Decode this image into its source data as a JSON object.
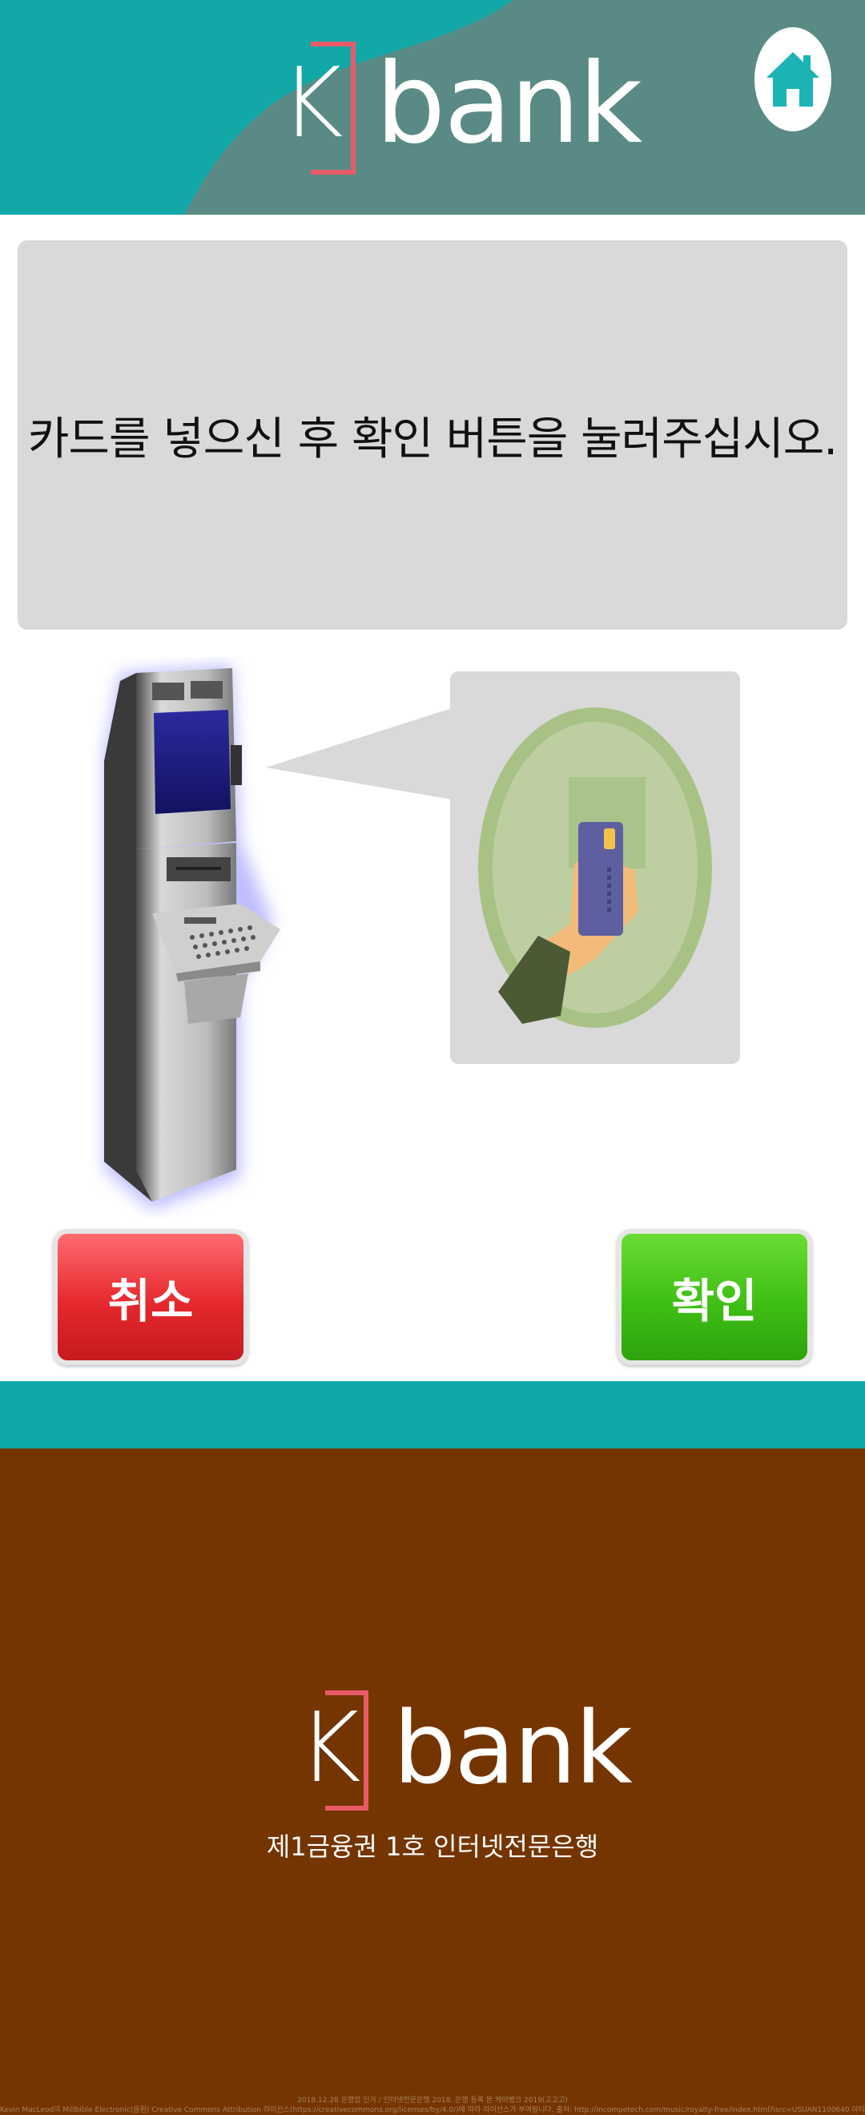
{
  "header": {
    "logo_letter": "K",
    "logo_word": "bank",
    "home_icon": "home-icon"
  },
  "instruction": {
    "text": "카드를 넣으신 후 확인 버튼을 눌러주십시오."
  },
  "illustration": {
    "atm": "atm-machine-image",
    "card": "hand-inserting-card-image"
  },
  "buttons": {
    "cancel_label": "취소",
    "confirm_label": "확인"
  },
  "footer": {
    "logo_letter": "K",
    "logo_word": "bank",
    "tagline": "제1금융권 1호 인터넷전문은행",
    "credit_line1": "2018.12.28 은행업 인가 / 인터넷전문은행 2018. 은행 등록 본 케이뱅크 2019(고고고)",
    "credit_line2": "Kevin MacLeod의 Millbible Electronic(음원) Creative Commons Attribution 라이선스(https://creativecommons.org/licenses/by/4.0/)에 따라 라이선스가 부여됩니다. 출처: http://incompetech.com/music/royalty-free/index.html?isrc=USUAN1100640 아티스트: http://incompetech.com/"
  },
  "colors": {
    "header_bg": "#5a8a86",
    "header_wave": "#12a8a8",
    "logo_bracket": "#e85a67",
    "panel_bg": "#d9d9d9",
    "cancel": "#e5282d",
    "confirm": "#3fbf15",
    "teal_band": "#0fa8a8",
    "footer_bg": "#753500"
  }
}
